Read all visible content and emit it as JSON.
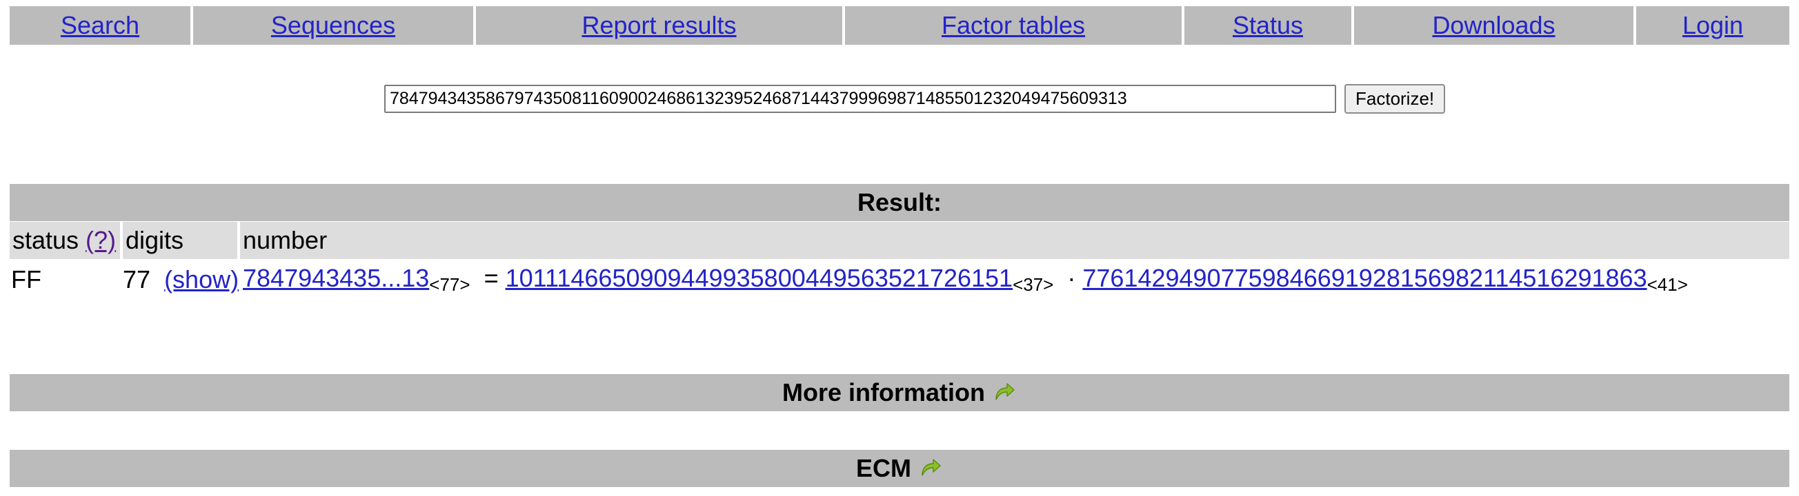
{
  "nav": {
    "items": [
      {
        "label": "Search"
      },
      {
        "label": "Sequences"
      },
      {
        "label": "Report results"
      },
      {
        "label": "Factor tables"
      },
      {
        "label": "Status"
      },
      {
        "label": "Downloads"
      },
      {
        "label": "Login"
      }
    ]
  },
  "search": {
    "value": "78479434358679743508116090024686132395246871443799969871485501232049475609313",
    "button_label": "Factorize!"
  },
  "result": {
    "header": "Result:",
    "columns": {
      "status": "status",
      "help": "(?)",
      "digits": "digits",
      "number": "number"
    },
    "row": {
      "status": "FF",
      "digits": "77",
      "show_label": "(show)",
      "number_short": "7847943435...13",
      "number_digits": "<77>",
      "equals": "=",
      "factor1": "1011146650909449935800449563521726151",
      "factor1_digits": "<37>",
      "times": "·",
      "factor2": "77614294907759846691928156982114516291863",
      "factor2_digits": "<41>"
    }
  },
  "sections": {
    "more_info": "More information",
    "ecm": "ECM"
  },
  "colors": {
    "header_bg": "#bbbbbb",
    "table_head_bg": "#dddddd",
    "link": "#2323c8",
    "visited_link": "#551a8b",
    "arrow_icon": "#8bbf2a"
  },
  "icons": {
    "more_info_arrow": "forward-arrow-icon",
    "ecm_arrow": "forward-arrow-icon"
  }
}
